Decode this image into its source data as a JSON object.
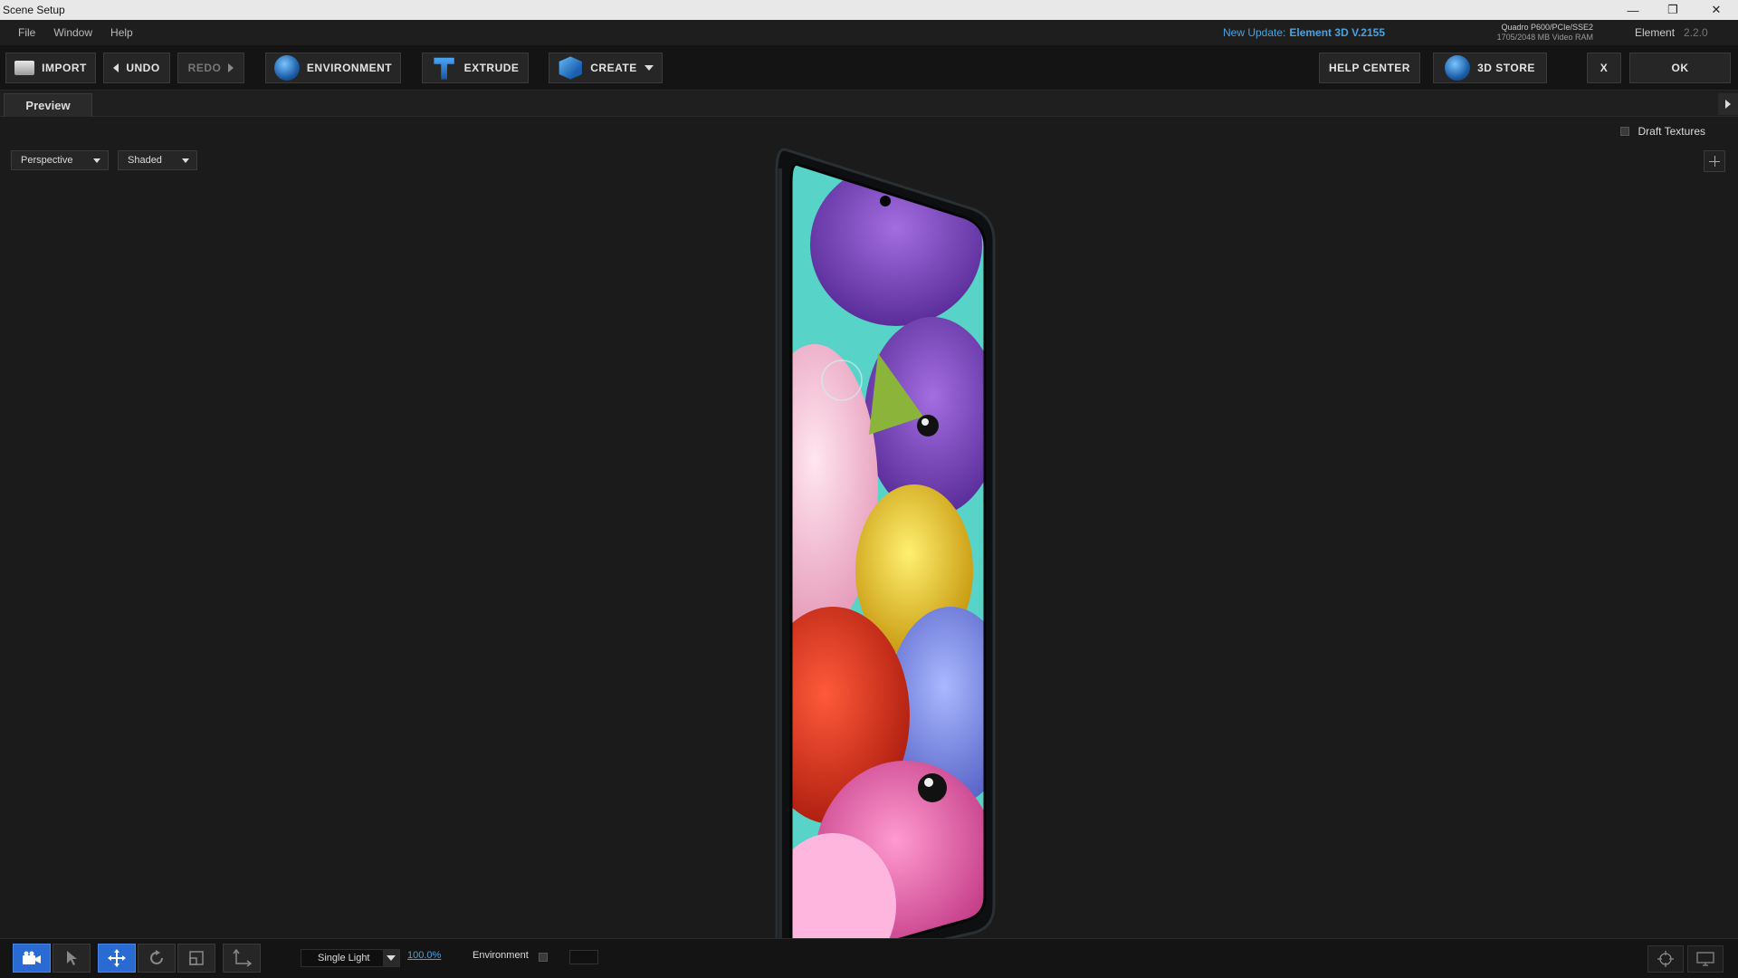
{
  "window": {
    "title": "Scene Setup",
    "minimize": "—",
    "restore": "❐",
    "close": "✕"
  },
  "menu": {
    "items": [
      "File",
      "Window",
      "Help"
    ]
  },
  "update": {
    "prefix": "New Update:",
    "version": "Element 3D V.2155"
  },
  "gpu": {
    "name": "Quadro P600/PCIe/SSE2",
    "memory": "1705/2048 MB Video RAM"
  },
  "app": {
    "name": "Element",
    "version": "2.2.0"
  },
  "toolbar": {
    "import": "IMPORT",
    "undo": "UNDO",
    "redo": "REDO",
    "environment": "ENVIRONMENT",
    "extrude": "EXTRUDE",
    "create": "CREATE",
    "help_center": "HELP CENTER",
    "store": "3D STORE",
    "close": "X",
    "ok": "OK"
  },
  "tabs": {
    "preview": "Preview"
  },
  "viewport": {
    "draft_textures": "Draft Textures",
    "camera_mode": "Perspective",
    "shading_mode": "Shaded"
  },
  "bottom": {
    "light_mode": "Single Light",
    "light_percent": "100.0%",
    "environment_label": "Environment"
  },
  "colors": {
    "accent": "#2a6ad3",
    "link": "#4aa3df",
    "screen_bg": "#57d3c8"
  }
}
